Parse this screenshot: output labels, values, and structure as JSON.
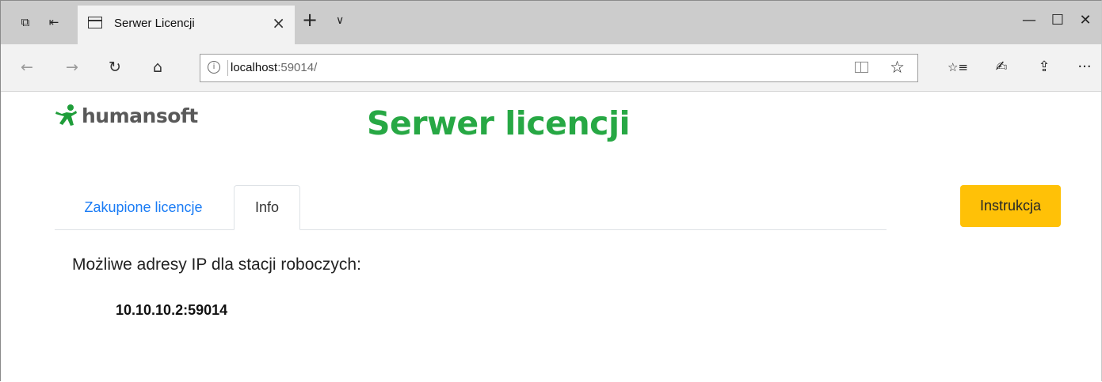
{
  "browser": {
    "tab_title": "Serwer Licencji",
    "close_glyph": "×",
    "new_tab_glyph": "+",
    "tab_menu_glyph": "∨",
    "window_controls": {
      "minimize": "—",
      "maximize": "☐",
      "close": "✕"
    },
    "address": {
      "host": "localhost",
      "port_path": ":59014/"
    },
    "icons": {
      "tab_preview": "tab-preview-icon",
      "set_aside": "set-aside-tabs-icon",
      "back": "back-arrow-icon",
      "forward": "forward-arrow-icon",
      "refresh": "refresh-icon",
      "home": "home-icon",
      "info": "site-info-icon",
      "reading_view": "reading-view-icon",
      "favorite": "star-icon",
      "favorites_hub": "favorites-list-icon",
      "notes": "pen-icon",
      "share": "share-icon",
      "more": "more-icon"
    },
    "glyphs": {
      "back": "←",
      "forward": "→",
      "refresh": "↻",
      "home": "⌂",
      "info": "i",
      "star": "☆",
      "favorites": "☆≡",
      "pen": "✍",
      "share": "⇪",
      "more": "···",
      "tab_preview": "⧉",
      "set_aside": "⇤"
    }
  },
  "page": {
    "logo_text": "humansoft",
    "title": "Serwer licencji",
    "tabs": [
      {
        "label": "Zakupione licencje",
        "active": false
      },
      {
        "label": "Info",
        "active": true
      }
    ],
    "instruction_button": "Instrukcja",
    "ip_label": "Możliwe adresy IP dla stacji roboczych:",
    "ip_addresses": [
      "10.10.10.2:59014"
    ]
  },
  "colors": {
    "title_green": "#27a844",
    "logo_green": "#1f9d3a",
    "link_blue": "#1a7cf5",
    "button_yellow": "#ffc107"
  }
}
